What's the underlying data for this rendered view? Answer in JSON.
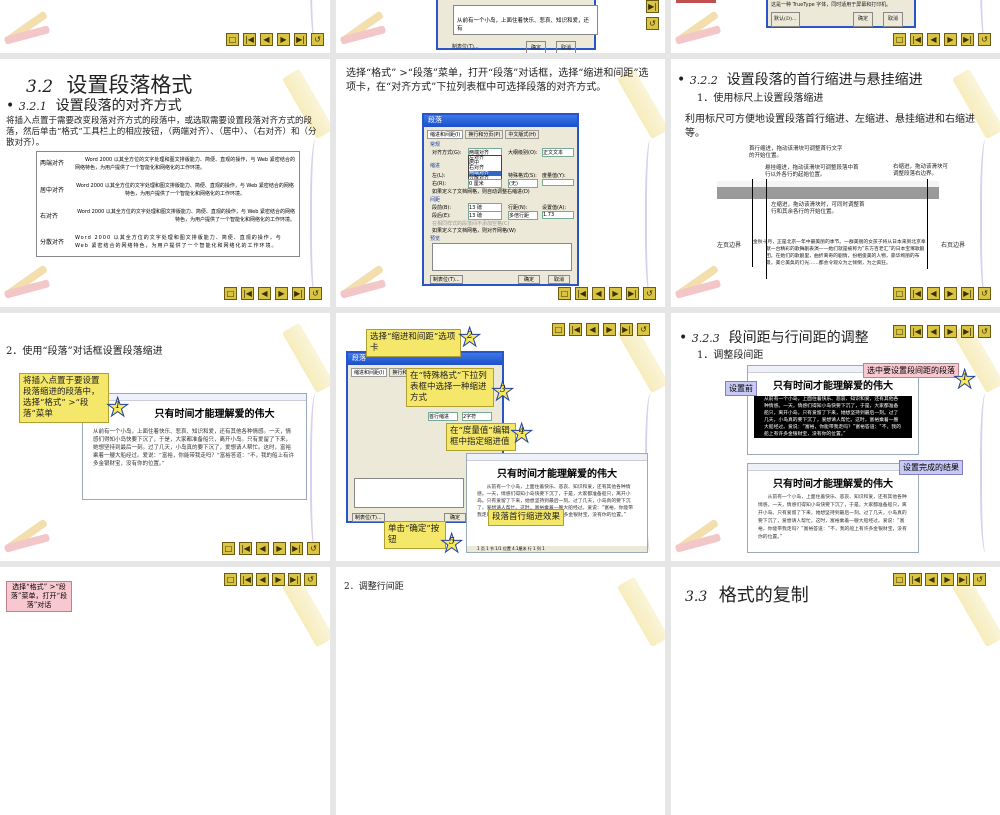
{
  "nav_buttons": [
    "home",
    "first",
    "previous",
    "next",
    "last",
    "return"
  ],
  "nav_glyphs": [
    "□",
    "|◀",
    "◀",
    "▶",
    "▶|",
    "↺"
  ],
  "top_row": {
    "s2_preview_text": "从前有一个小岛，上面住着快乐、悲哀、知识和爱，还有",
    "ok": "确定",
    "cancel": "取消",
    "tabs_btn": "制表位(T)...",
    "s3_hint": "这是一种 TrueType 字体，同时适用于屏幕和打印机。",
    "default_btn": "默认(D)..."
  },
  "slide_a": {
    "num": "3.2",
    "title": "设置段落格式",
    "sub_num": "3.2.1",
    "subtitle": "设置段落的对齐方式",
    "body": "将插入点置于需要改变段落对齐方式的段落中，或选取需要设置段落对齐方式的段落，然后单击“格式”工具栏上的相应按钮，（两端对齐）、（居中）、（右对齐）和（分散对齐）。",
    "rows": [
      {
        "label": "两端对齐",
        "text": "Word 2000 以其全方位的文字处理和图文排版能力、简便、直观的操作，与 Web 紧密结合的网络特色，为用户提供了一个智能化和网络化的工作环境。"
      },
      {
        "label": "居中对齐",
        "text": "Word 2000 以其全方位的文字处理和图文排版能力、简便、直观的操作，与 Web 紧密结合的网络特色，为用户提供了一个智能化和网络化的工作环境。"
      },
      {
        "label": "右对齐",
        "text": "Word 2000 以其全方位的文字处理和图文排版能力、简便、直观的操作，与 Web 紧密结合的网络特色，为用户提供了一个智能化和网络化的工作环境。"
      },
      {
        "label": "分散对齐",
        "text": "Word 2000 以其全方位的文字处理和图文排版能力、简便、直观的操作，与 Web 紧密结合的网络特色，为用户提供了一个智能化和网络化的工作环境。"
      }
    ]
  },
  "slide_b": {
    "body": "选择“格式” >“段落”菜单，打开“段落”对话框，选择“缩进和间距”选项卡，在“对齐方式”下拉列表框中可选择段落的对齐方式。",
    "dialog_title": "段落",
    "tabs": [
      "缩进和间距(I)",
      "换行和分页(P)",
      "中文版式(H)"
    ],
    "general": "常规",
    "align_label": "对齐方式(G):",
    "align_value": "两端对齐",
    "outline_label": "大纲级别(O):",
    "outline_value": "正文文本",
    "options": [
      "左对齐",
      "居中",
      "右对齐",
      "两端对齐",
      "分散对齐"
    ],
    "indent": "缩进",
    "left": "左(L):",
    "right": "右(R):",
    "right_value": "0 厘米",
    "special": "特殊格式(S):",
    "special_value": "(无)",
    "by": "度量值(Y):",
    "grid1": "如果定义了文档网格，则自动调整右缩进(D)",
    "spacing": "间距",
    "before": "段前(B):",
    "before_value": "13 磅",
    "after": "段后(E):",
    "after_value": "13 磅",
    "line": "行距(N):",
    "line_value": "多倍行距",
    "at": "设置值(A):",
    "at_value": "1.73",
    "nospace": "在相同样式的段落间不添加空格(C)",
    "grid2": "如果定义了文档网格，则对齐网格(W)",
    "preview": "预览",
    "tabs_btn": "制表位(T)...",
    "ok": "确定",
    "cancel": "取消"
  },
  "slide_c": {
    "sub_num": "3.2.2",
    "subtitle": "设置段落的首行缩进与悬挂缩进",
    "item": "1．使用标尺上设置段落缩进",
    "body": "利用标尺可方便地设置段落首行缩进、左缩进、悬挂缩进和右缩进等。",
    "first_line": "首行缩进，拖动该滑块可调整首行文字的开始位置。",
    "hanging": "悬挂缩进，拖动该滑块可调整段落中首行以外各行的起始位置。",
    "right_indent": "右缩进，拖动该滑块可调整段落右边界。",
    "left_indent": "左缩进，拖动该滑块时，可同时调整首行和其余各行的开始位置。",
    "left_margin": "左页边界",
    "right_margin": "右页边界",
    "ruler_ticks": [
      "2",
      "4",
      "6",
      "8",
      "10",
      "12",
      "14",
      "16",
      "18",
      "20",
      "22",
      "24",
      "26",
      "28",
      "30",
      "32",
      "34",
      "36",
      "38"
    ],
    "sample": "金秋十月，正是北京一年中最美丽的季节。一群美丽的女孩子将从日本来到北京奉献一台精彩的歌舞剧表演——她们就是被称为“东方百老汇”的日本宝塚歌剧团。在她们的歌剧里，曲折离奇的剧情，扮相俊美的人物，豪华绚丽的布景，美仑美奂的灯光……都会令观众为之倾倒，为之疯狂。"
  },
  "slide_d": {
    "item": "2．使用“段落”对话框设置段落缩进",
    "callout": "将插入点置于要设置段落缩进的段落中，选择“格式” >“段落”菜单",
    "step": "1",
    "doc_title": "只有时间才能理解爱的伟大",
    "doc_text": "从前有一个小岛，上面住着快乐、悲哀、知识和爱，还有其他各种情感。一天，情感们得知小岛快要下沉了，于是，大家都准备船只，离开小岛。只有爱留了下来，她想坚持到最后一刻。过了几天，小岛真的要下沉了，爱想请人帮忙。这时，富裕乘着一艘大船经过。爱说：“富裕，你能带我走吗？”富裕答道：“不，我的船上有许多金银财宝，没有你的位置。”"
  },
  "slide_e": {
    "call2": "选择“缩进和间距”选项卡",
    "step2": "2",
    "call3": "在“特殊格式”下拉列表框中选择一种缩进方式",
    "step3": "3",
    "call4": "在“度量值”编辑框中指定缩进值",
    "step4": "4",
    "call5": "单击“确定”按钮",
    "step5": "5",
    "effect": "段落首行缩进效果",
    "special_value": "首行缩进",
    "by_value": "2字符",
    "status": "1 页   1 节   1/1   位置 4.1厘米   行 1  列 1"
  },
  "slide_f": {
    "sub_num": "3.2.3",
    "subtitle": "段间距与行间距的调整",
    "item": "1．调整段间距",
    "select_call": "选中要设置段间距的段落",
    "step": "1",
    "before": "设置前",
    "after": "设置完成的结果"
  },
  "row4": {
    "a_callout": "选择“格式” >“段落”菜单，打开“段落”对话",
    "b_item": "2．调整行间距",
    "c_num": "3.3",
    "c_title": "格式的复制"
  }
}
